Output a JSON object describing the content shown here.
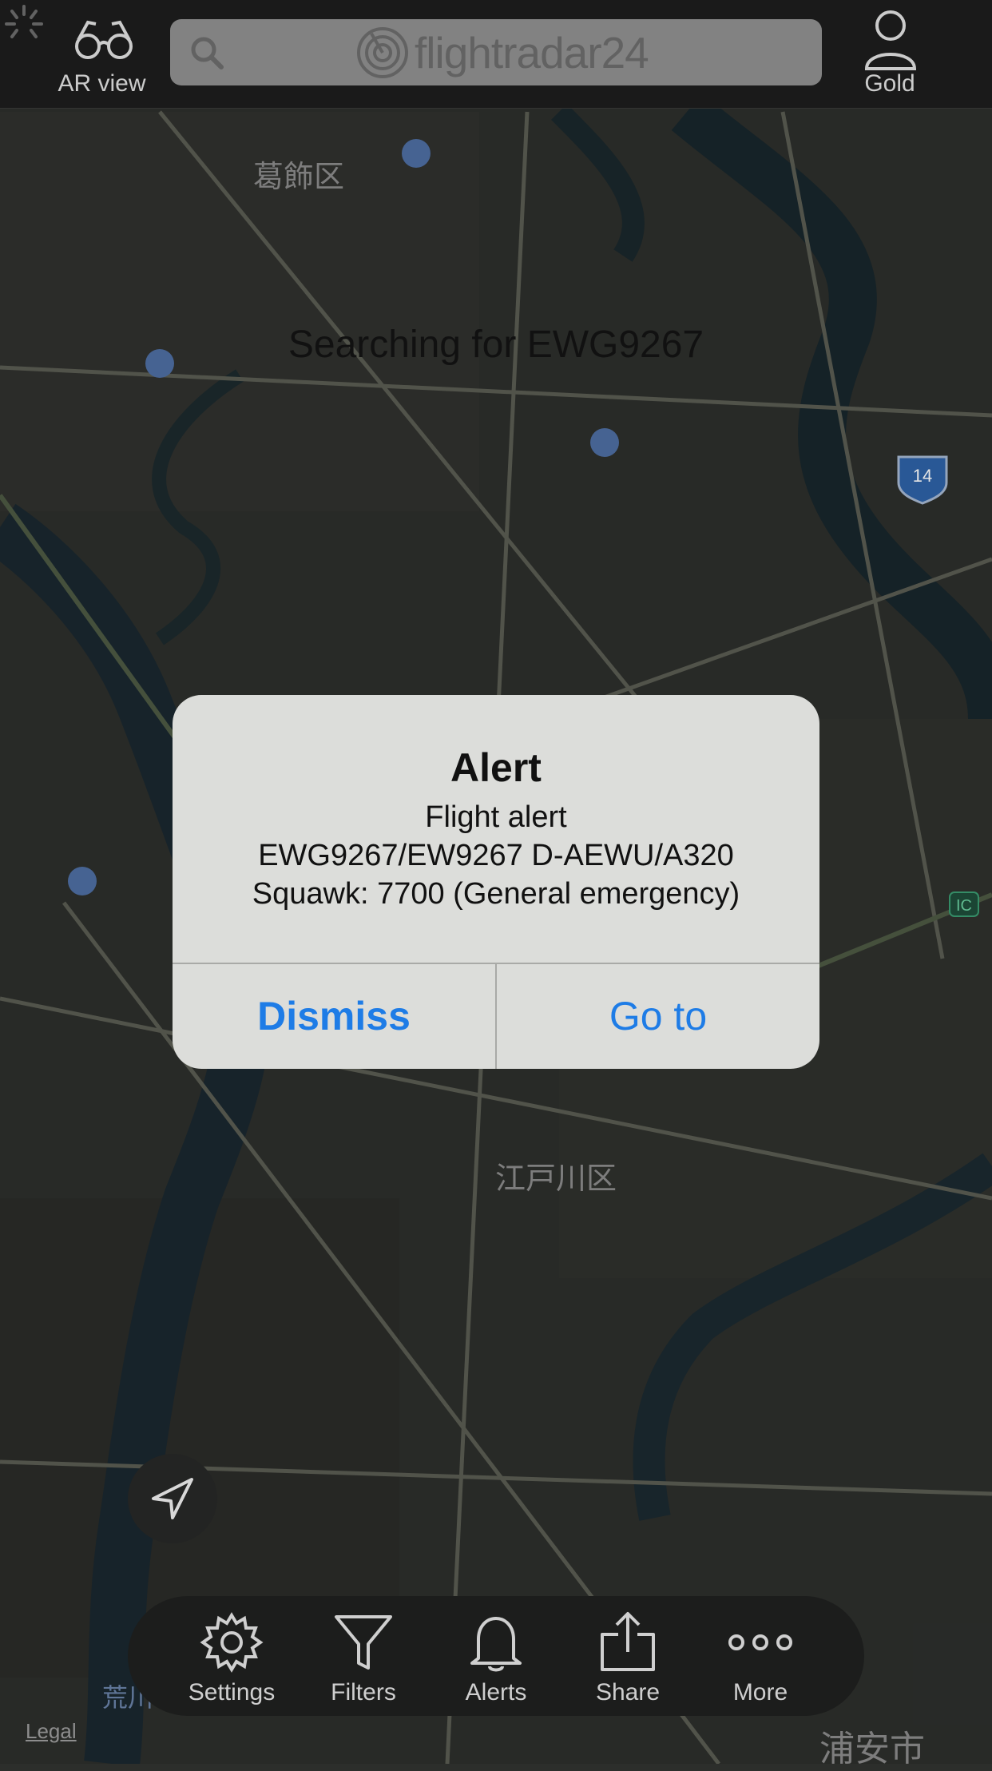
{
  "header": {
    "ar_view_label": "AR view",
    "search_brand": "flightradar24",
    "gold_label": "Gold"
  },
  "map": {
    "status_text": "Searching for EWG9267",
    "labels": {
      "katsushika": "葛飾区",
      "edogawa": "江戸川区",
      "urayasu": "浦安市",
      "arakawa": "荒川",
      "highway_number": "14",
      "ic_marker": "IC"
    },
    "legal_link": "Legal"
  },
  "alert": {
    "title": "Alert",
    "line1": "Flight alert",
    "line2": "EWG9267/EW9267 D-AEWU/A320",
    "line3": "Squawk: 7700 (General emergency)",
    "dismiss_label": "Dismiss",
    "goto_label": "Go to",
    "button_color": "#1e7ce6"
  },
  "tabbar": {
    "items": [
      {
        "label": "Settings",
        "icon": "gear-icon"
      },
      {
        "label": "Filters",
        "icon": "filter-icon"
      },
      {
        "label": "Alerts",
        "icon": "bell-icon"
      },
      {
        "label": "Share",
        "icon": "share-icon"
      },
      {
        "label": "More",
        "icon": "more-icon"
      }
    ]
  }
}
